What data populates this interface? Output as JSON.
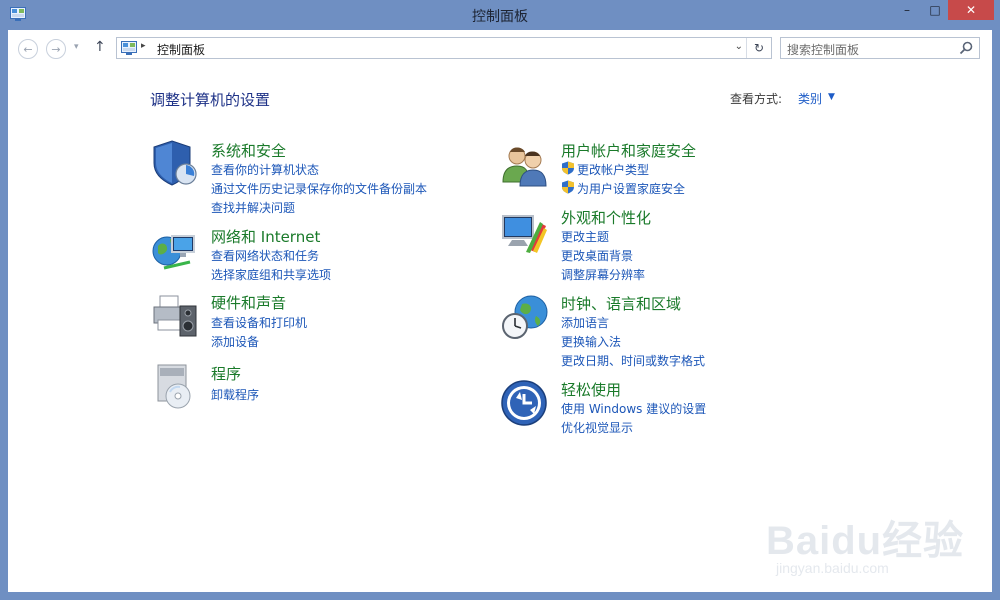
{
  "window": {
    "title": "控制面板",
    "minimize": "–",
    "maximize": "□",
    "close": "✕"
  },
  "nav": {
    "back": "←",
    "forward": "→",
    "history": "▾",
    "up": "↑",
    "address_sep": "▸",
    "address": "控制面板",
    "address_dropdown": "⌄",
    "refresh": "↻",
    "search_placeholder": "搜索控制面板"
  },
  "main": {
    "heading": "调整计算机的设置",
    "view_by_label": "查看方式:",
    "view_by_value": "类别",
    "view_by_arrow": "▼"
  },
  "categories": {
    "system": {
      "title": "系统和安全",
      "links": [
        "查看你的计算机状态",
        "通过文件历史记录保存你的文件备份副本",
        "查找并解决问题"
      ]
    },
    "network": {
      "title": "网络和 Internet",
      "links": [
        "查看网络状态和任务",
        "选择家庭组和共享选项"
      ]
    },
    "hardware": {
      "title": "硬件和声音",
      "links": [
        "查看设备和打印机",
        "添加设备"
      ]
    },
    "programs": {
      "title": "程序",
      "links": [
        "卸载程序"
      ]
    },
    "accounts": {
      "title": "用户帐户和家庭安全",
      "links": [
        "更改帐户类型",
        "为用户设置家庭安全"
      ]
    },
    "appearance": {
      "title": "外观和个性化",
      "links": [
        "更改主题",
        "更改桌面背景",
        "调整屏幕分辨率"
      ]
    },
    "clock": {
      "title": "时钟、语言和区域",
      "links": [
        "添加语言",
        "更换输入法",
        "更改日期、时间或数字格式"
      ]
    },
    "ease": {
      "title": "轻松使用",
      "links": [
        "使用 Windows 建议的设置",
        "优化视觉显示"
      ]
    }
  },
  "watermark": {
    "text": "Baidu经验",
    "sub": "jingyan.baidu.com"
  }
}
